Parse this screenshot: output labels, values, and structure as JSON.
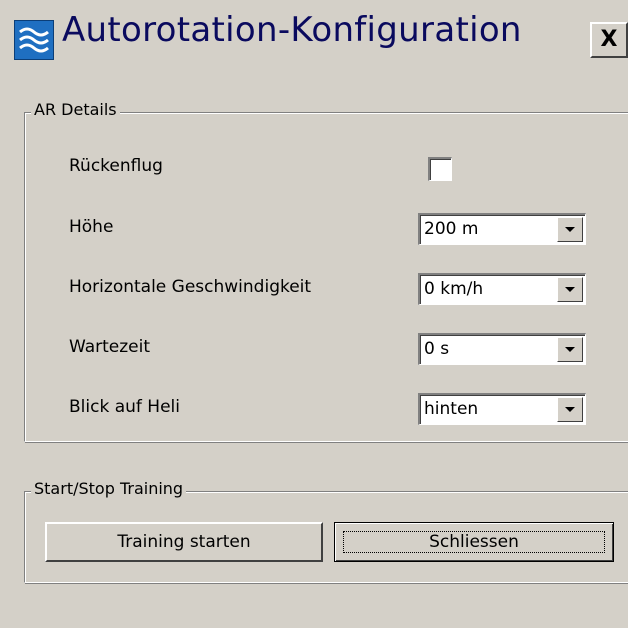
{
  "window": {
    "title": "Autorotation-Konfiguration",
    "close_label": "X"
  },
  "icons": {
    "app": "app-waves-icon",
    "close": "close-icon",
    "dropdown": "chevron-down-icon"
  },
  "colors": {
    "background": "#d4d0c8",
    "title_text": "#0a0a5e",
    "app_icon": "#1f6fc1"
  },
  "ar_details": {
    "group_label": "AR Details",
    "rows": [
      {
        "label": "Rückenflug",
        "type": "checkbox",
        "checked": false
      },
      {
        "label": "Höhe",
        "type": "combo",
        "value": "200 m"
      },
      {
        "label": "Horizontale Geschwindigkeit",
        "type": "combo",
        "value": "0 km/h"
      },
      {
        "label": "Wartezeit",
        "type": "combo",
        "value": "0 s"
      },
      {
        "label": "Blick auf Heli",
        "type": "combo",
        "value": "hinten"
      }
    ]
  },
  "training": {
    "group_label": "Start/Stop Training",
    "start_label": "Training starten",
    "close_label": "Schliessen"
  }
}
